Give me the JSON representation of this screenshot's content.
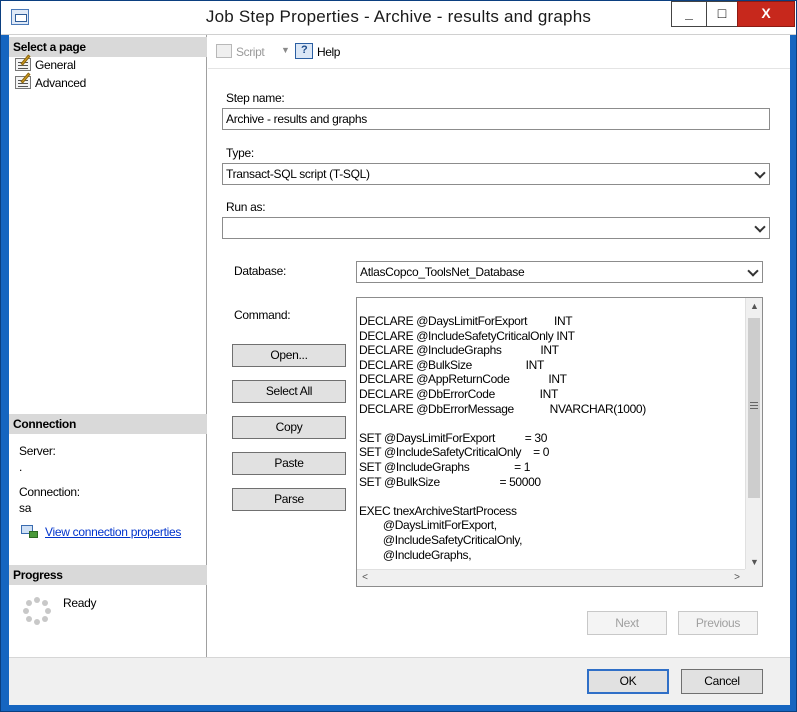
{
  "window": {
    "title": "Job Step Properties - Archive - results and graphs",
    "minimize_label": "_",
    "maximize_label": "□",
    "close_label": "X"
  },
  "left_pane": {
    "select_page_header": "Select a page",
    "pages": [
      {
        "label": "General",
        "icon": "properties-page-icon"
      },
      {
        "label": "Advanced",
        "icon": "properties-page-icon"
      }
    ],
    "connection_header": "Connection",
    "server_label": "Server:",
    "server_value": ".",
    "connection_label": "Connection:",
    "connection_value": "sa",
    "view_connection_link": "View connection properties",
    "progress_header": "Progress",
    "progress_status": "Ready"
  },
  "toolbar": {
    "script_label": "Script",
    "help_label": "Help"
  },
  "form": {
    "step_name_label": "Step name:",
    "step_name_value": "Archive - results and graphs",
    "type_label": "Type:",
    "type_value": "Transact-SQL script (T-SQL)",
    "run_as_label": "Run as:",
    "run_as_value": "",
    "database_label": "Database:",
    "database_value": "AtlasCopco_ToolsNet_Database",
    "command_label": "Command:"
  },
  "command_buttons": {
    "open": "Open...",
    "select_all": "Select All",
    "copy": "Copy",
    "paste": "Paste",
    "parse": "Parse"
  },
  "command_text": "DECLARE @DaysLimitForExport         INT\nDECLARE @IncludeSafetyCriticalOnly INT\nDECLARE @IncludeGraphs             INT\nDECLARE @BulkSize                  INT\nDECLARE @AppReturnCode             INT\nDECLARE @DbErrorCode               INT\nDECLARE @DbErrorMessage            NVARCHAR(1000)\n\nSET @DaysLimitForExport          = 30\nSET @IncludeSafetyCriticalOnly    = 0\nSET @IncludeGraphs               = 1\nSET @BulkSize                    = 50000\n\nEXEC tnexArchiveStartProcess\n        @DaysLimitForExport,\n        @IncludeSafetyCriticalOnly,\n        @IncludeGraphs,",
  "navigation": {
    "next": "Next",
    "previous": "Previous"
  },
  "footer": {
    "ok": "OK",
    "cancel": "Cancel"
  }
}
